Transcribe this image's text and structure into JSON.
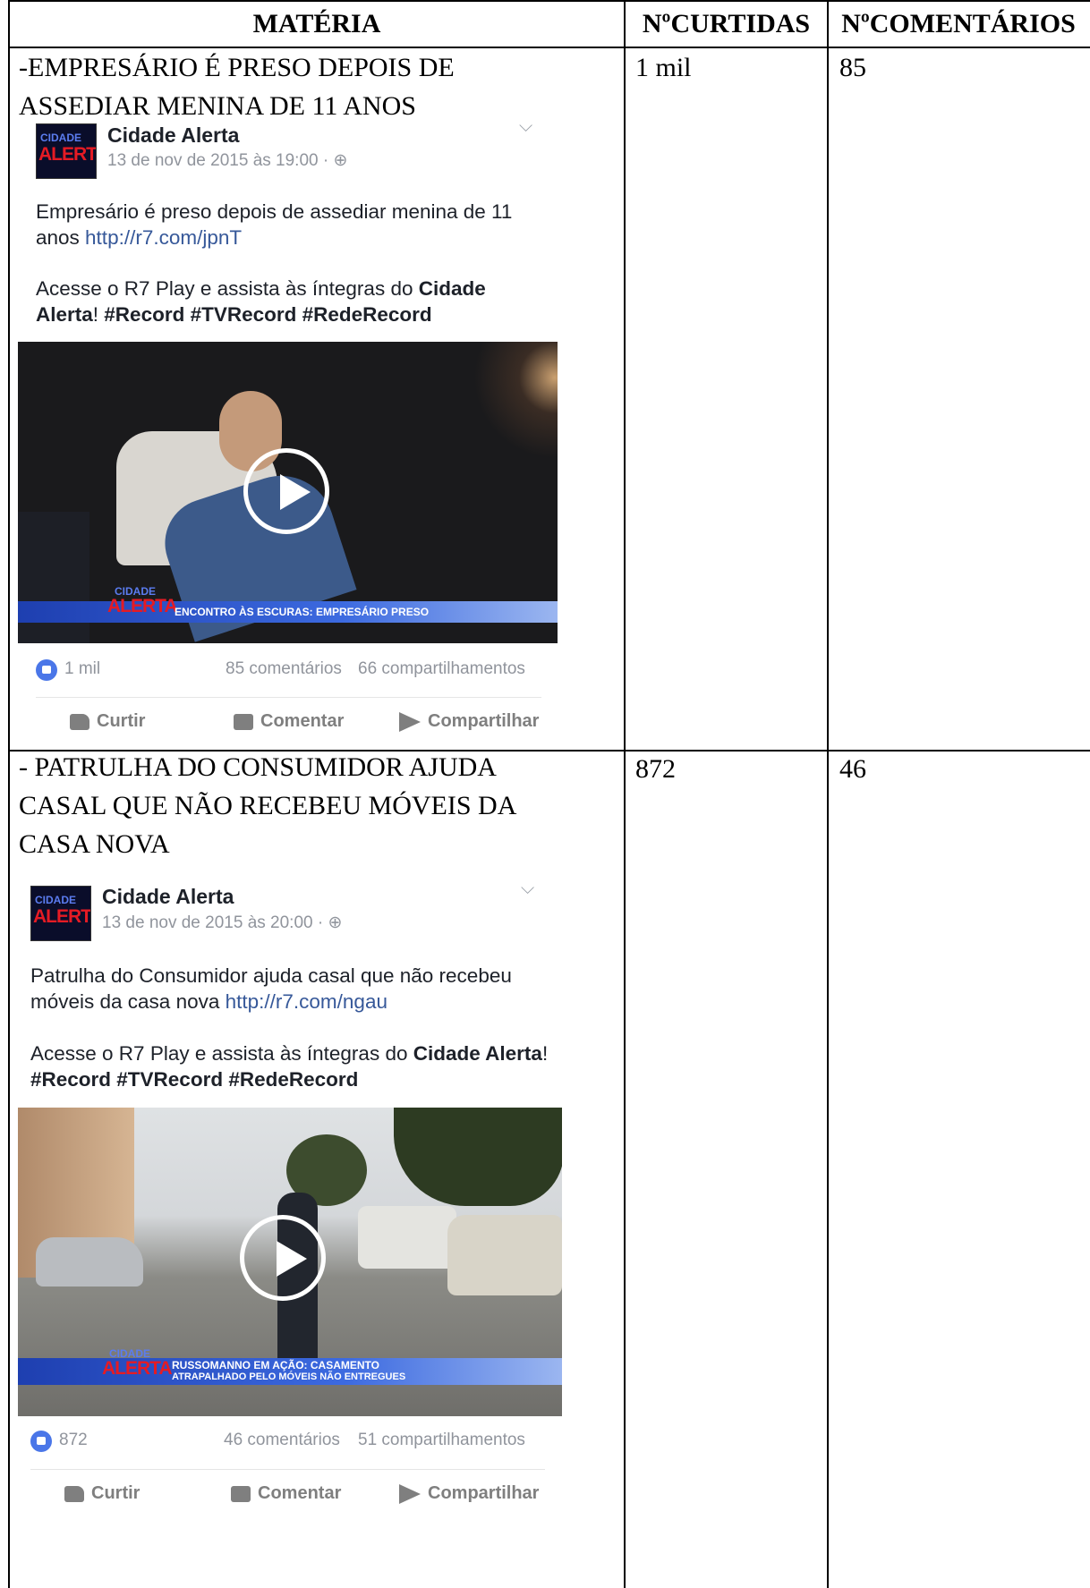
{
  "table": {
    "headers": {
      "materia": "MATÉRIA",
      "curtidas": "NºCURTIDAS",
      "comentarios": "NºCOMENTÁRIOS"
    },
    "rows": [
      {
        "title_line1": "-EMPRESÁRIO É PRESO DEPOIS DE",
        "title_line2": "ASSEDIAR MENINA DE 11 ANOS",
        "curtidas": "1 mil",
        "comentarios": "85",
        "post": {
          "logo_top": "CIDADE",
          "logo_bottom": "ALERTA",
          "page_name": "Cidade Alerta",
          "date": "13 de nov de 2015 às 19:00 · ⊕",
          "text_main": "Empresário é preso depois de assediar menina de 11 anos ",
          "link": "http://r7.com/jpnT",
          "cta_prefix": "Acesse o R7 Play e assista às íntegras do ",
          "cta_bold1": "Cidade Alerta",
          "cta_suffix": "! ",
          "hashtags": "#Record #TVRecord #RedeRecord",
          "video_banner": "ENCONTRO ÀS ESCURAS: EMPRESÁRIO PRESO",
          "banner_logo_top": "CIDADE",
          "banner_logo_bottom": "ALERTA",
          "likes": "1 mil",
          "comments": "85 comentários",
          "shares": "66 compartilhamentos",
          "action_like": "Curtir",
          "action_comment": "Comentar",
          "action_share": "Compartilhar"
        }
      },
      {
        "title_line1": "- PATRULHA DO CONSUMIDOR AJUDA",
        "title_line2": "CASAL QUE NÃO RECEBEU MÓVEIS DA",
        "title_line3": "CASA NOVA",
        "curtidas": "872",
        "comentarios": "46",
        "post": {
          "logo_top": "CIDADE",
          "logo_bottom": "ALERTA",
          "page_name": "Cidade Alerta",
          "date": "13 de nov de 2015 às 20:00 · ⊕",
          "text_main": "Patrulha do Consumidor ajuda casal que não recebeu móveis da casa nova ",
          "link": "http://r7.com/ngau",
          "cta_prefix": "Acesse o R7 Play e assista às íntegras do ",
          "cta_bold1": "Cidade Alerta",
          "cta_suffix": "! ",
          "hashtags": "#Record #TVRecord #RedeRecord",
          "video_banner_line1": "RUSSOMANNO EM AÇÃO: CASAMENTO",
          "video_banner_line2": "ATRAPALHADO PELO MÓVEIS NÃO ENTREGUES",
          "banner_logo_top": "CIDADE",
          "banner_logo_bottom": "ALERTA",
          "likes": "872",
          "comments": "46 comentários",
          "shares": "51 compartilhamentos",
          "action_like": "Curtir",
          "action_comment": "Comentar",
          "action_share": "Compartilhar"
        }
      }
    ]
  }
}
